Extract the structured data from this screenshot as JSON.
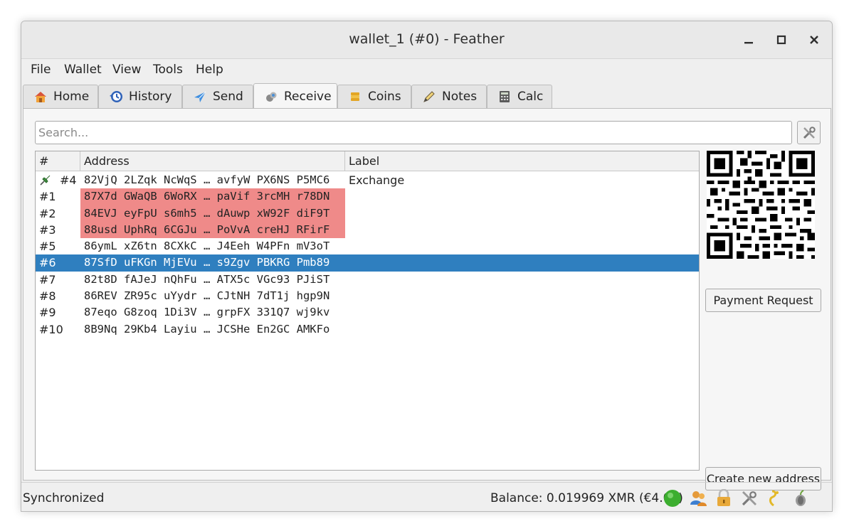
{
  "window": {
    "title": "wallet_1 (#0) - Feather"
  },
  "menu": [
    "File",
    "Wallet",
    "View",
    "Tools",
    "Help"
  ],
  "tabs": [
    {
      "label": "Home",
      "icon": "home-icon"
    },
    {
      "label": "History",
      "icon": "history-icon"
    },
    {
      "label": "Send",
      "icon": "send-icon"
    },
    {
      "label": "Receive",
      "icon": "receive-icon",
      "active": true
    },
    {
      "label": "Coins",
      "icon": "coins-icon"
    },
    {
      "label": "Notes",
      "icon": "notes-icon"
    },
    {
      "label": "Calc",
      "icon": "calc-icon"
    }
  ],
  "search": {
    "placeholder": "Search..."
  },
  "table": {
    "columns": [
      "#",
      "Address",
      "Label"
    ],
    "rows": [
      {
        "num": "#4",
        "address": "82VjQ 2LZqk NcWqS … avfyW PX6NS P5MC6",
        "label": "Exchange",
        "pinned": true,
        "state": "normal"
      },
      {
        "num": "#1",
        "address": "87X7d GWaQB 6WoRX … paVif 3rcMH r78DN",
        "label": "",
        "state": "used"
      },
      {
        "num": "#2",
        "address": "84EVJ eyFpU s6mh5 … dAuwp xW92F diF9T",
        "label": "",
        "state": "used"
      },
      {
        "num": "#3",
        "address": "88usd UphRq 6CGJu … PoVvA creHJ RFirF",
        "label": "",
        "state": "used"
      },
      {
        "num": "#5",
        "address": "86ymL xZ6tn 8CXkC … J4Eeh W4PFn mV3oT",
        "label": "",
        "state": "normal"
      },
      {
        "num": "#6",
        "address": "87SfD uFKGn MjEVu … s9Zgv PBKRG Pmb89",
        "label": "",
        "state": "selected"
      },
      {
        "num": "#7",
        "address": "82t8D fAJeJ nQhFu … ATX5c VGc93 PJiST",
        "label": "",
        "state": "normal"
      },
      {
        "num": "#8",
        "address": "86REV ZR95c uYydr … CJtNH 7dT1j hgp9N",
        "label": "",
        "state": "normal"
      },
      {
        "num": "#9",
        "address": "87eqo G8zoq 1Di3V … grpFX 331Q7 wj9kv",
        "label": "",
        "state": "normal"
      },
      {
        "num": "#10",
        "address": "8B9Nq 29Kb4 Layiu … JCSHe En2GC AMKFo",
        "label": "",
        "state": "normal"
      }
    ]
  },
  "buttons": {
    "payment_request": "Payment Request",
    "create_address": "Create new address"
  },
  "status": {
    "text": "Synchronized",
    "balance": "Balance: 0.019969 XMR (€4.02)",
    "icons": [
      "connection-status-icon",
      "contacts-icon",
      "lock-icon",
      "settings-icon",
      "seed-icon",
      "tor-icon"
    ]
  },
  "colors": {
    "used_row": "#ef8a89",
    "selected_row": "#2f7fbf",
    "connected": "#3cae2f"
  }
}
